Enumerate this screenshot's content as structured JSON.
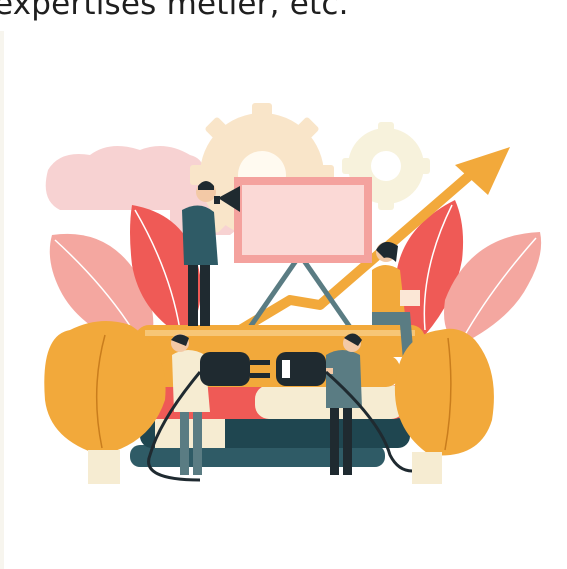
{
  "caption": {
    "text": "expertises métier, etc."
  },
  "illustration": {
    "icon": "teamwork-connection-illustration",
    "colors": {
      "cream": "#f6ecd2",
      "pink": "#f5c8c8",
      "coral": "#ef6b5b",
      "orange": "#f2a93b",
      "teal": "#2f5b66",
      "dark": "#1f2a30",
      "peach": "#f7d4a8"
    }
  }
}
